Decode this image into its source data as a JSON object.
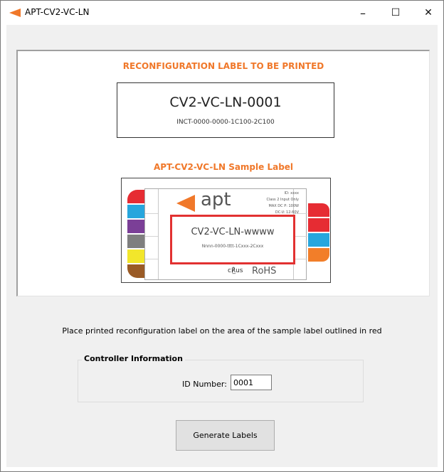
{
  "window": {
    "title": "APT-CV2-VC-LN",
    "icon": "apt-orange-arrow-icon",
    "controls": {
      "minimize": "–",
      "maximize": "☐",
      "close": "✕"
    }
  },
  "print_section": {
    "heading": "RECONFIGURATION LABEL TO BE PRINTED",
    "label_main": "CV2-VC-LN-0001",
    "label_sub": "INCT-0000-0000-1C100-2C100"
  },
  "sample_section": {
    "heading": "APT-CV2-VC-LN Sample Label",
    "brand": "apt",
    "specs": [
      "ID: xxxx",
      "Class 2 Input Only",
      "MAX DC P: 100W",
      "DC-V: 12-60V"
    ],
    "area_main": "CV2-VC-LN-wwww",
    "area_sub": "Nnnn-0000-tttt-1Cxxx-2Cxxx",
    "cert_mark": "c℟̲us",
    "rohs": "RoHS",
    "colors": {
      "accent": "#f0782a",
      "outline": "#e23131",
      "left_strip": [
        "#e62c33",
        "#27a6dd",
        "#7b3f97",
        "#7f7f7f",
        "#f2e62b",
        "#9a5b26"
      ],
      "right_strip": [
        "#e62c33",
        "#e62c33",
        "#27a6dd",
        "#f27e29"
      ]
    }
  },
  "instruction": "Place printed reconfiguration label on the area of the sample label outlined in red",
  "controller": {
    "legend": "Controller Information",
    "id_label": "ID Number:",
    "id_value": "0001"
  },
  "generate_button": "Generate Labels"
}
